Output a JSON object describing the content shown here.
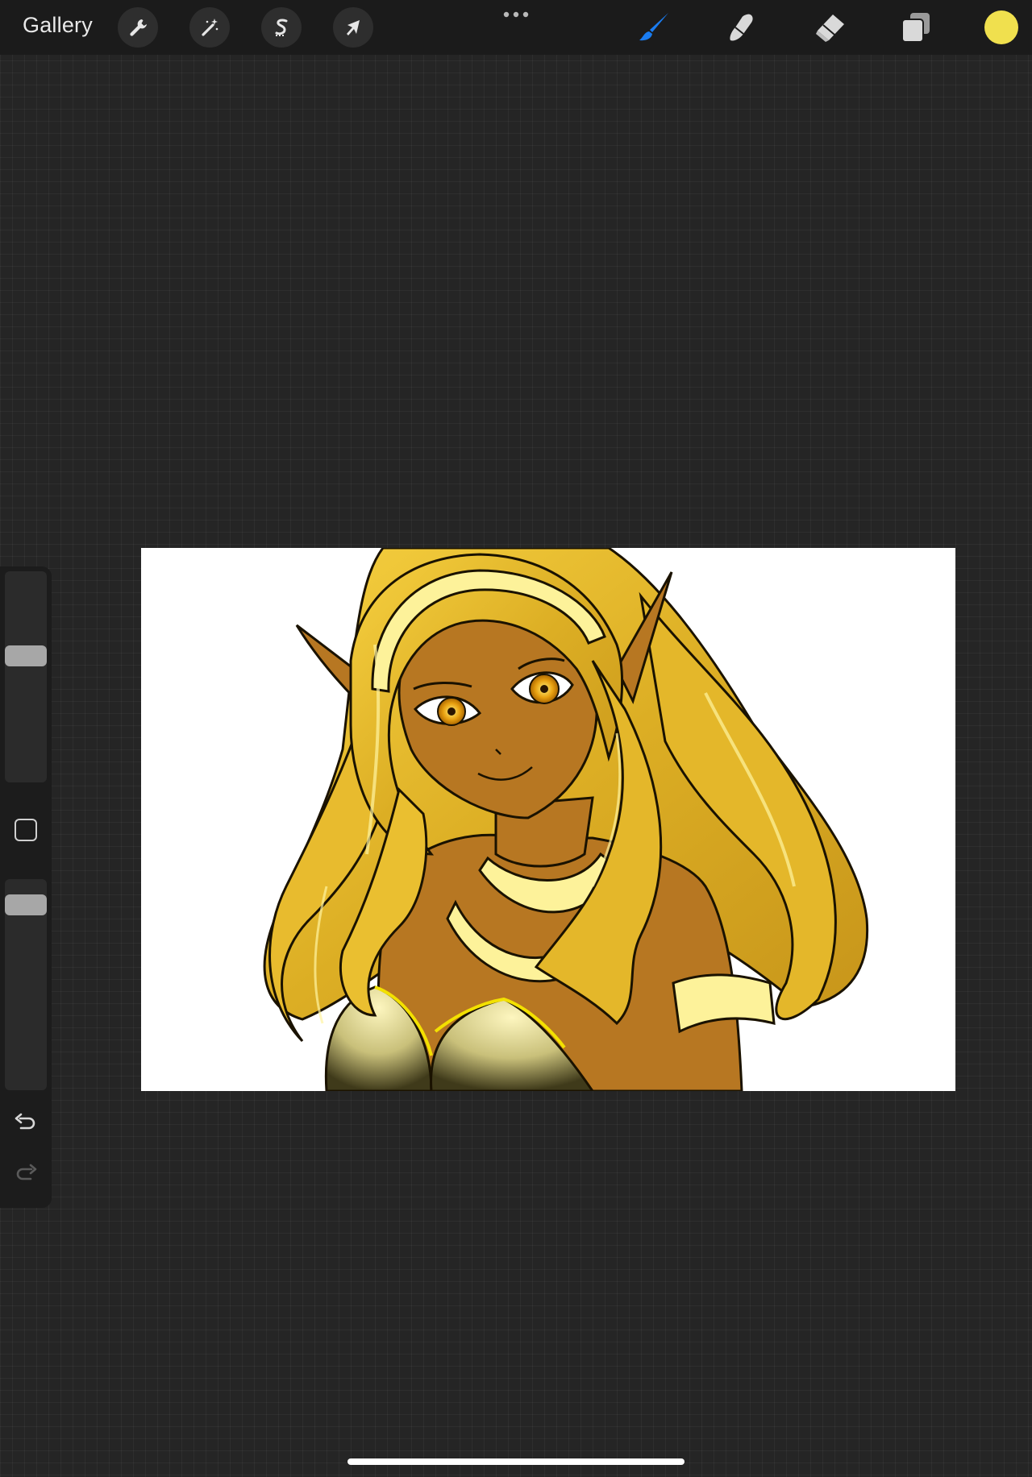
{
  "topbar": {
    "gallery_label": "Gallery",
    "left_tools": [
      {
        "name": "actions",
        "icon": "wrench-icon"
      },
      {
        "name": "adjustments",
        "icon": "magic-wand-icon"
      },
      {
        "name": "selection",
        "icon": "selection-s-icon"
      },
      {
        "name": "transform",
        "icon": "arrow-cursor-icon"
      }
    ],
    "center_icon": "more-dots-icon",
    "right_tools": [
      {
        "name": "brush",
        "icon": "brush-icon",
        "active": true
      },
      {
        "name": "smudge",
        "icon": "smudge-icon",
        "active": false
      },
      {
        "name": "eraser",
        "icon": "eraser-icon",
        "active": false
      },
      {
        "name": "layers",
        "icon": "layers-icon",
        "active": false
      }
    ],
    "current_color": "#f0e04e"
  },
  "sidebar": {
    "brush_size_level": 0.61,
    "opacity_level": 0.92,
    "modify_icon": "square-modify-icon",
    "undo_icon": "undo-arrow-icon",
    "redo_icon": "redo-arrow-icon"
  },
  "colors": {
    "accent": "#1a7cf0",
    "topbar_bg": "#1b1b1b",
    "canvas_bg": "#ffffff",
    "hair": "#e0b72a",
    "skin": "#b77722",
    "accessory": "#fdf29a",
    "home_indicator": "#ffffff"
  },
  "canvas": {
    "artwork": "elf-girl-illustration"
  }
}
